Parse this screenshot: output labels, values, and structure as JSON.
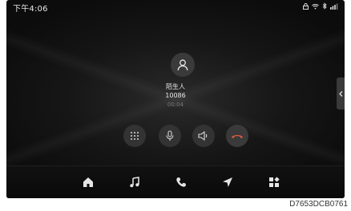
{
  "status_bar": {
    "time": "下午4:06",
    "icons": [
      "lock-icon",
      "wifi-icon",
      "bluetooth-icon",
      "signal-icon"
    ]
  },
  "call": {
    "caller_name": "陌生人",
    "caller_number": "10086",
    "duration": "00:04"
  },
  "controls": [
    "keypad-icon",
    "microphone-icon",
    "speaker-icon",
    "hang-up-icon"
  ],
  "dock": [
    "home-icon",
    "music-icon",
    "phone-icon",
    "navigation-icon",
    "apps-icon"
  ],
  "colors": {
    "hangup": "#e05a3a",
    "background": "#141414"
  },
  "reference_code": "D7653DCB0761"
}
